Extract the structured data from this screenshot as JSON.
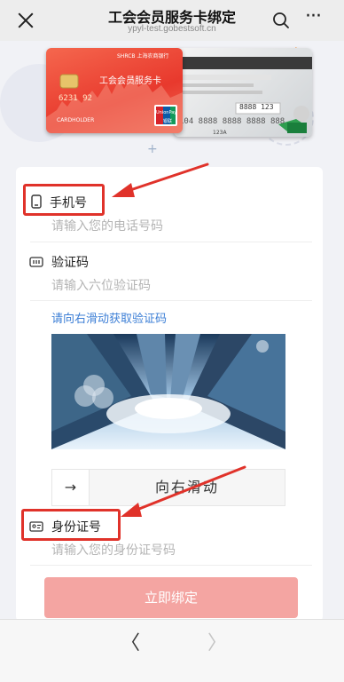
{
  "navbar": {
    "title": "工会会员服务卡绑定",
    "subtitle": "ypyl-test.gobestsoft.cn",
    "close_icon": "close-icon",
    "search_icon": "search-icon",
    "more_icon": "more-icon",
    "more_glyph": "···"
  },
  "hero": {
    "red_card": {
      "title": "工会会员服务卡",
      "bank": "SHRCB 上海农商银行",
      "number": "6231 92",
      "holder": "CARDHOLDER",
      "union_pay": "UnionPay",
      "union_pay_cn": "银联"
    },
    "grey_card": {
      "number_a": "8888 123",
      "number_b": "104 8888 8888 8888 888",
      "code": "123A"
    }
  },
  "form": {
    "phone": {
      "label": "手机号",
      "placeholder": "请输入您的电话号码",
      "icon": "phone-icon"
    },
    "code": {
      "label": "验证码",
      "placeholder": "请输入六位验证码",
      "icon": "keypad-icon"
    },
    "slide_hint": "请向右滑动获取验证码",
    "slider": {
      "handle_glyph": "→",
      "text": "向右滑动"
    },
    "id_card": {
      "label": "身份证号",
      "placeholder": "请输入您的身份证号码",
      "icon": "id-card-icon"
    },
    "submit_label": "立即绑定"
  },
  "bottom_nav": {
    "back_glyph": "〈",
    "forward_glyph": "〉",
    "back_icon": "chevron-left-icon",
    "forward_icon": "chevron-right-icon"
  },
  "colors": {
    "highlight": "#e0322a",
    "link": "#3d7fd6",
    "button": "#f4a5a2"
  }
}
